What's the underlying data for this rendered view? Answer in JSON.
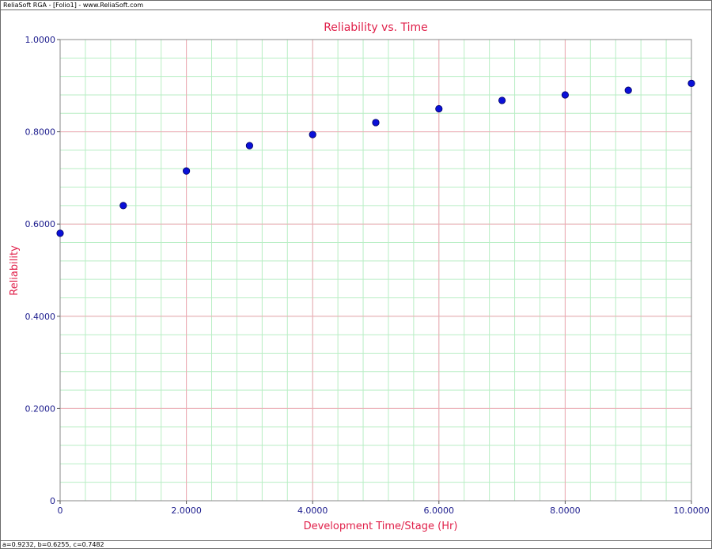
{
  "window": {
    "title": "ReliaSoft RGA - [Folio1] - www.ReliaSoft.com"
  },
  "status": {
    "text": "a=0.9232, b=0.6255, c=0.7482"
  },
  "colors": {
    "title_text": "#e0204a",
    "tick_text": "#1a1a8c",
    "major_grid": "#f2a6b4",
    "minor_grid": "#b8eec4",
    "marker_fill": "#0a10d8",
    "marker_stroke": "#000060"
  },
  "chart_data": {
    "type": "scatter",
    "title": "Reliability vs. Time",
    "xlabel": "Development Time/Stage (Hr)",
    "ylabel": "Reliability",
    "xlim": [
      0,
      10
    ],
    "ylim": [
      0,
      1
    ],
    "grid": true,
    "x_ticks": [
      0,
      2,
      4,
      6,
      8,
      10
    ],
    "x_tick_labels": [
      "0",
      "2.0000",
      "4.0000",
      "6.0000",
      "8.0000",
      "10.0000"
    ],
    "y_ticks": [
      0,
      0.2,
      0.4,
      0.6,
      0.8,
      1.0
    ],
    "y_tick_labels": [
      "0",
      "0.2000",
      "0.4000",
      "0.6000",
      "0.8000",
      "1.0000"
    ],
    "series": [
      {
        "x": [
          0,
          1,
          2,
          3,
          4,
          5,
          6,
          7,
          8,
          9,
          10
        ],
        "y": [
          0.58,
          0.64,
          0.715,
          0.77,
          0.794,
          0.82,
          0.85,
          0.868,
          0.88,
          0.89,
          0.905
        ]
      }
    ]
  }
}
